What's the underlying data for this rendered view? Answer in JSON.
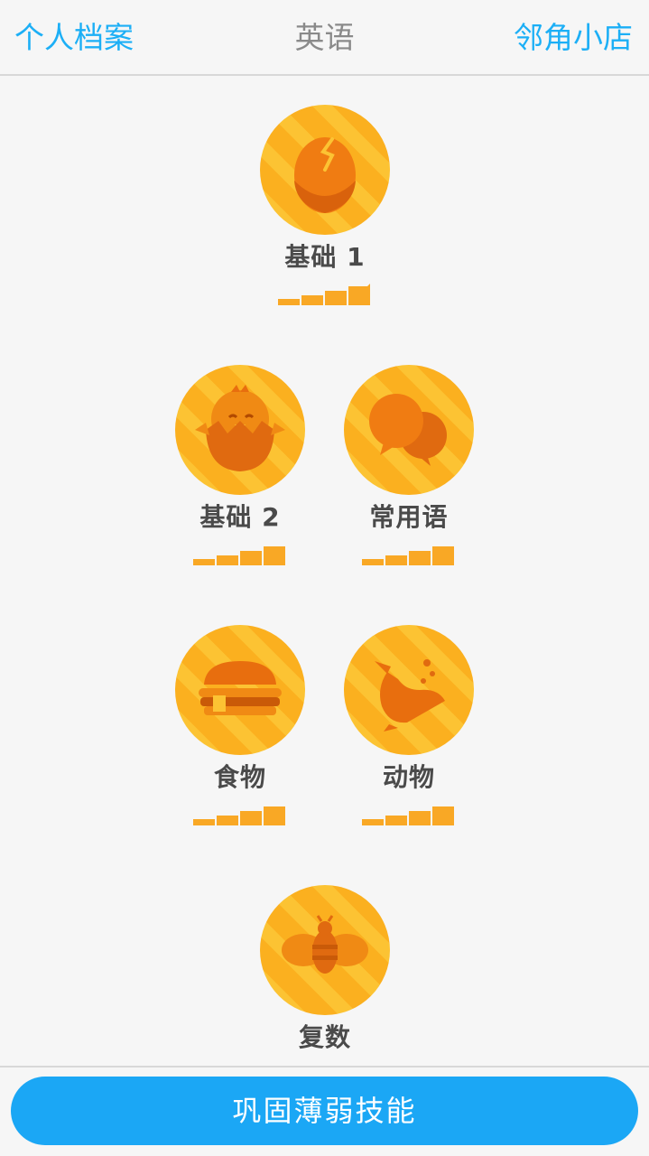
{
  "header": {
    "profile_label": "个人档案",
    "title": "英语",
    "store_label": "邻角小店"
  },
  "skills": [
    {
      "label": "基础 1",
      "icon": "egg-icon",
      "strength_bars": 4
    },
    {
      "label": "基础 2",
      "icon": "chick-icon",
      "strength_bars": 4
    },
    {
      "label": "常用语",
      "icon": "speech-bubbles-icon",
      "strength_bars": 4
    },
    {
      "label": "食物",
      "icon": "hamburger-icon",
      "strength_bars": 4
    },
    {
      "label": "动物",
      "icon": "whale-icon",
      "strength_bars": 4
    },
    {
      "label": "复数",
      "icon": "bee-icon",
      "strength_bars": 4
    }
  ],
  "footer": {
    "practice_button_label": "巩固薄弱技能"
  },
  "colors": {
    "accent_blue": "#1caff6",
    "button_blue": "#1ba7f5",
    "coin_gold": "#fbb01f",
    "icon_orange": "#e86e0e",
    "strength_gold": "#f9a825"
  }
}
